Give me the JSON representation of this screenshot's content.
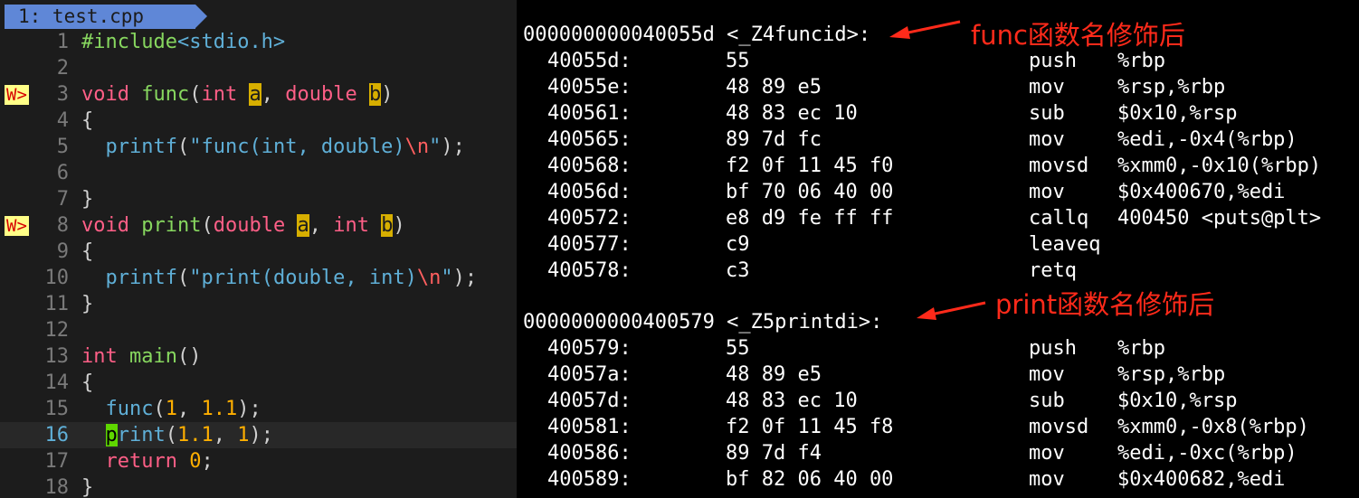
{
  "editor": {
    "tab_label": "1: test.cpp",
    "lines": [
      {
        "n": "1",
        "sign": "",
        "tokens": [
          [
            "#include",
            "green"
          ],
          [
            "<stdio.h>",
            "blue"
          ]
        ]
      },
      {
        "n": "2",
        "sign": "",
        "tokens": []
      },
      {
        "n": "3",
        "sign": "W>",
        "tokens": [
          [
            "void",
            "pink"
          ],
          [
            " ",
            "gray"
          ],
          [
            "func",
            "green"
          ],
          [
            "(",
            "gray"
          ],
          [
            "int",
            "pink"
          ],
          [
            " ",
            "gray"
          ],
          [
            "a",
            "hl"
          ],
          [
            ", ",
            "gray"
          ],
          [
            "double",
            "pink"
          ],
          [
            " ",
            "gray"
          ],
          [
            "b",
            "hl"
          ],
          [
            ")",
            "gray"
          ]
        ]
      },
      {
        "n": "4",
        "sign": "",
        "tokens": [
          [
            "{",
            "gray"
          ]
        ]
      },
      {
        "n": "5",
        "sign": "",
        "tokens": [
          [
            "  ",
            "gray"
          ],
          [
            "printf",
            "blue"
          ],
          [
            "(",
            "gray"
          ],
          [
            "\"func(int, double)",
            "blue"
          ],
          [
            "\\n",
            "red"
          ],
          [
            "\"",
            "blue"
          ],
          [
            ");",
            "gray"
          ]
        ]
      },
      {
        "n": "6",
        "sign": "",
        "tokens": []
      },
      {
        "n": "7",
        "sign": "",
        "tokens": [
          [
            "}",
            "gray"
          ]
        ]
      },
      {
        "n": "8",
        "sign": "W>",
        "tokens": [
          [
            "void",
            "pink"
          ],
          [
            " ",
            "gray"
          ],
          [
            "print",
            "green"
          ],
          [
            "(",
            "gray"
          ],
          [
            "double",
            "pink"
          ],
          [
            " ",
            "gray"
          ],
          [
            "a",
            "hl"
          ],
          [
            ", ",
            "gray"
          ],
          [
            "int",
            "pink"
          ],
          [
            " ",
            "gray"
          ],
          [
            "b",
            "hl"
          ],
          [
            ")",
            "gray"
          ]
        ]
      },
      {
        "n": "9",
        "sign": "",
        "tokens": [
          [
            "{",
            "gray"
          ]
        ]
      },
      {
        "n": "10",
        "sign": "",
        "tokens": [
          [
            "  ",
            "gray"
          ],
          [
            "printf",
            "blue"
          ],
          [
            "(",
            "gray"
          ],
          [
            "\"print(double, int)",
            "blue"
          ],
          [
            "\\n",
            "red"
          ],
          [
            "\"",
            "blue"
          ],
          [
            ");",
            "gray"
          ]
        ]
      },
      {
        "n": "11",
        "sign": "",
        "tokens": [
          [
            "}",
            "gray"
          ]
        ]
      },
      {
        "n": "12",
        "sign": "",
        "tokens": []
      },
      {
        "n": "13",
        "sign": "",
        "tokens": [
          [
            "int",
            "pink"
          ],
          [
            " ",
            "gray"
          ],
          [
            "main",
            "green"
          ],
          [
            "()",
            "gray"
          ]
        ]
      },
      {
        "n": "14",
        "sign": "",
        "tokens": [
          [
            "{",
            "gray"
          ]
        ]
      },
      {
        "n": "15",
        "sign": "",
        "tokens": [
          [
            "  ",
            "gray"
          ],
          [
            "func",
            "blue"
          ],
          [
            "(",
            "gray"
          ],
          [
            "1",
            "orange"
          ],
          [
            ", ",
            "gray"
          ],
          [
            "1.1",
            "orange"
          ],
          [
            ");",
            "gray"
          ]
        ]
      },
      {
        "n": "16",
        "sign": "",
        "current": true,
        "tokens": [
          [
            "  ",
            "gray"
          ],
          [
            "p",
            "cursor"
          ],
          [
            "rint",
            "blue"
          ],
          [
            "(",
            "gray"
          ],
          [
            "1.1",
            "orange"
          ],
          [
            ", ",
            "gray"
          ],
          [
            "1",
            "orange"
          ],
          [
            ");",
            "gray"
          ]
        ]
      },
      {
        "n": "17",
        "sign": "",
        "tokens": [
          [
            "  ",
            "gray"
          ],
          [
            "return",
            "pink"
          ],
          [
            " ",
            "gray"
          ],
          [
            "0",
            "orange"
          ],
          [
            ";",
            "gray"
          ]
        ]
      },
      {
        "n": "18",
        "sign": "",
        "tokens": [
          [
            "}",
            "gray"
          ]
        ]
      }
    ]
  },
  "objdump": {
    "sections": [
      {
        "label": "000000000040055d <_Z4funcid>:",
        "annotation": "func函数名修饰后",
        "rows": [
          {
            "addr": "40055d:",
            "bytes": "55",
            "mnem": "push",
            "ops": "%rbp"
          },
          {
            "addr": "40055e:",
            "bytes": "48 89 e5",
            "mnem": "mov",
            "ops": "%rsp,%rbp"
          },
          {
            "addr": "400561:",
            "bytes": "48 83 ec 10",
            "mnem": "sub",
            "ops": "$0x10,%rsp"
          },
          {
            "addr": "400565:",
            "bytes": "89 7d fc",
            "mnem": "mov",
            "ops": "%edi,-0x4(%rbp)"
          },
          {
            "addr": "400568:",
            "bytes": "f2 0f 11 45 f0",
            "mnem": "movsd",
            "ops": "%xmm0,-0x10(%rbp)"
          },
          {
            "addr": "40056d:",
            "bytes": "bf 70 06 40 00",
            "mnem": "mov",
            "ops": "$0x400670,%edi"
          },
          {
            "addr": "400572:",
            "bytes": "e8 d9 fe ff ff",
            "mnem": "callq",
            "ops": "400450 <puts@plt>"
          },
          {
            "addr": "400577:",
            "bytes": "c9",
            "mnem": "leaveq",
            "ops": ""
          },
          {
            "addr": "400578:",
            "bytes": "c3",
            "mnem": "retq",
            "ops": ""
          }
        ]
      },
      {
        "label": "0000000000400579 <_Z5printdi>:",
        "annotation": "print函数名修饰后",
        "rows": [
          {
            "addr": "400579:",
            "bytes": "55",
            "mnem": "push",
            "ops": "%rbp"
          },
          {
            "addr": "40057a:",
            "bytes": "48 89 e5",
            "mnem": "mov",
            "ops": "%rsp,%rbp"
          },
          {
            "addr": "40057d:",
            "bytes": "48 83 ec 10",
            "mnem": "sub",
            "ops": "$0x10,%rsp"
          },
          {
            "addr": "400581:",
            "bytes": "f2 0f 11 45 f8",
            "mnem": "movsd",
            "ops": "%xmm0,-0x8(%rbp)"
          },
          {
            "addr": "400586:",
            "bytes": "89 7d f4",
            "mnem": "mov",
            "ops": "%edi,-0xc(%rbp)"
          },
          {
            "addr": "400589:",
            "bytes": "bf 82 06 40 00",
            "mnem": "mov",
            "ops": "$0x400682,%edi"
          }
        ]
      }
    ]
  }
}
